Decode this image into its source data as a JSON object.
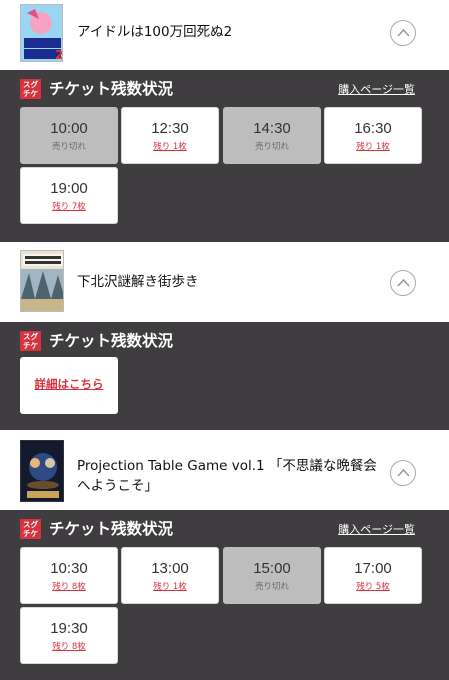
{
  "events": [
    {
      "title": "アイドルは100万回死ぬ2",
      "tickets_heading": "チケット残数状況",
      "purchase_link": "購入ページ一覧",
      "slots": [
        {
          "time": "10:00",
          "status": "売り切れ",
          "sold_out": true
        },
        {
          "time": "12:30",
          "status": "残り 1枚",
          "sold_out": false
        },
        {
          "time": "14:30",
          "status": "売り切れ",
          "sold_out": true
        },
        {
          "time": "16:30",
          "status": "残り 1枚",
          "sold_out": false
        },
        {
          "time": "19:00",
          "status": "残り 7枚",
          "sold_out": false
        }
      ]
    },
    {
      "title": "下北沢謎解き街歩き",
      "tickets_heading": "チケット残数状況",
      "details_link": "詳細はこちら"
    },
    {
      "title_line1": "Projection Table Game vol.1 「不思議な晩餐会",
      "title_line2": "へようこそ」",
      "tickets_heading": "チケット残数状況",
      "purchase_link": "購入ページ一覧",
      "slots": [
        {
          "time": "10:30",
          "status": "残り 8枚",
          "sold_out": false
        },
        {
          "time": "13:00",
          "status": "残り 1枚",
          "sold_out": false
        },
        {
          "time": "15:00",
          "status": "売り切れ",
          "sold_out": true
        },
        {
          "time": "17:00",
          "status": "残り 5枚",
          "sold_out": false
        },
        {
          "time": "19:30",
          "status": "残り 8枚",
          "sold_out": false
        }
      ]
    }
  ],
  "badge": {
    "line1": "スグ",
    "line2": "チケ"
  },
  "colors": {
    "accent_red": "#d8323e",
    "panel_bg": "#3f3d3f",
    "sold_out_bg": "#bdbdbd"
  }
}
